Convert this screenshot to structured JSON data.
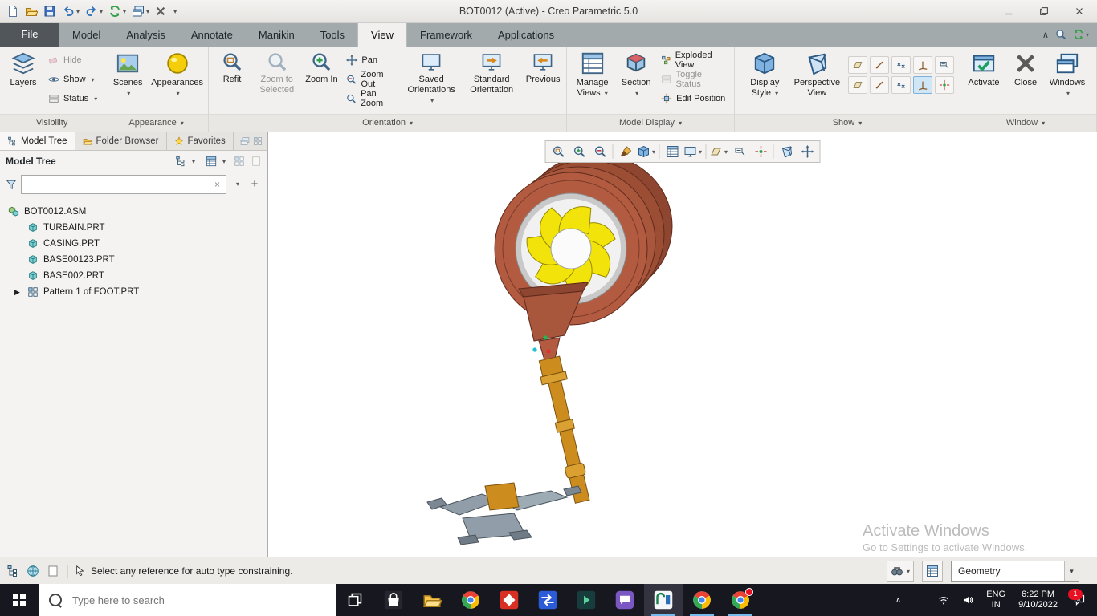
{
  "titlebar": {
    "title": "BOT0012 (Active) - Creo Parametric 5.0"
  },
  "tabs": [
    "File",
    "Model",
    "Analysis",
    "Annotate",
    "Manikin",
    "Tools",
    "View",
    "Framework",
    "Applications"
  ],
  "ribbon": {
    "visibility": {
      "label": "Visibility",
      "layers": "Layers",
      "hide": "Hide",
      "show": "Show",
      "status": "Status"
    },
    "appearance": {
      "label": "Appearance",
      "scenes": "Scenes",
      "appearances": "Appearances"
    },
    "orientation": {
      "label": "Orientation",
      "refit": "Refit",
      "zoom_to_selected": "Zoom to Selected",
      "zoom_in": "Zoom In",
      "pan": "Pan",
      "zoom_out": "Zoom Out",
      "pan_zoom": "Pan Zoom",
      "saved_orientations": "Saved Orientations",
      "standard_orientation": "Standard Orientation",
      "previous": "Previous"
    },
    "model_display": {
      "label": "Model Display",
      "manage_views": "Manage Views",
      "section": "Section",
      "exploded_view": "Exploded View",
      "toggle_status": "Toggle Status",
      "edit_position": "Edit Position"
    },
    "show": {
      "label": "Show",
      "display_style": "Display Style",
      "perspective_view": "Perspective View"
    },
    "window": {
      "label": "Window",
      "activate": "Activate",
      "close": "Close",
      "windows": "Windows"
    }
  },
  "left_panel": {
    "tabs": [
      {
        "label": "Model Tree"
      },
      {
        "label": "Folder Browser"
      },
      {
        "label": "Favorites"
      }
    ],
    "header": "Model Tree",
    "tree": [
      {
        "label": "BOT0012.ASM",
        "type": "assembly"
      },
      {
        "label": "TURBAIN.PRT",
        "type": "part"
      },
      {
        "label": "CASING.PRT",
        "type": "part"
      },
      {
        "label": "BASE00123.PRT",
        "type": "part"
      },
      {
        "label": "BASE002.PRT",
        "type": "part"
      },
      {
        "label": "Pattern 1 of FOOT.PRT",
        "type": "pattern"
      }
    ]
  },
  "graphics": {
    "watermark_title": "Activate Windows",
    "watermark_sub": "Go to Settings to activate Windows."
  },
  "statusbar": {
    "message": "Select any reference for auto type constraining.",
    "selection_filter": "Geometry"
  },
  "taskbar": {
    "search_placeholder": "Type here to search",
    "language": "ENG",
    "region": "IN",
    "time": "6:22 PM",
    "date": "9/10/2022",
    "notification_count": "1"
  },
  "icons": {
    "new": "document",
    "open": "folder",
    "save": "floppy-disk",
    "undo": "arrow-curve-left",
    "redo": "arrow-curve-right",
    "regenerate": "circular-arrows",
    "refit": "magnifier-fit",
    "zoom_in": "magnifier-plus",
    "zoom_out": "magnifier-minus",
    "pan": "cross-arrows",
    "appearances": "yellow-sphere",
    "scenes": "landscape-image",
    "display_style": "shaded-cube",
    "section": "cut-cube",
    "activate": "window-check",
    "close": "x-mark",
    "windows": "stacked-windows",
    "find": "binoculars",
    "selection_cursor": "arrow-cursor",
    "chrome": "chrome-circle",
    "file_explorer": "yellow-folder"
  },
  "colors": {
    "housing": "#b25b40",
    "blades": "#f2e30b",
    "stand": "#cd8c1e",
    "feet": "#919ea9",
    "accent": "#2b6fb8",
    "taskbar_bg": "#17171f",
    "watermark": "#bcbcbc"
  }
}
